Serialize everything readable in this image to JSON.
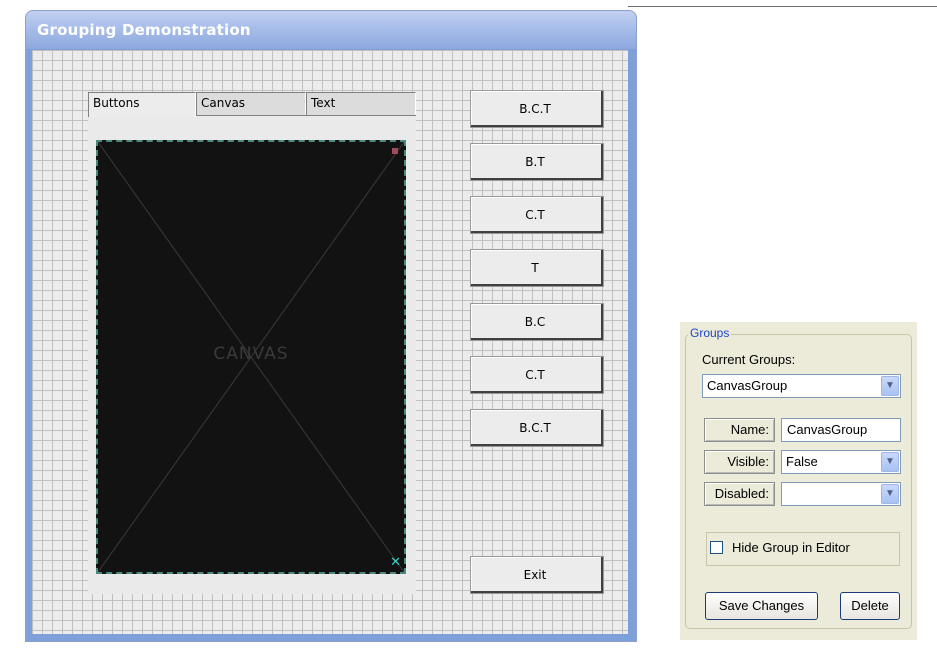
{
  "window": {
    "title": "Grouping Demonstration"
  },
  "tabs": [
    {
      "label": "Buttons"
    },
    {
      "label": "Canvas"
    },
    {
      "label": "Text"
    }
  ],
  "canvas": {
    "label": "CANVAS"
  },
  "side_buttons": [
    {
      "label": "B.C.T"
    },
    {
      "label": "B.T"
    },
    {
      "label": "C.T"
    },
    {
      "label": "T"
    },
    {
      "label": "B.C"
    },
    {
      "label": "C.T"
    },
    {
      "label": "B.C.T"
    }
  ],
  "exit_button": {
    "label": "Exit"
  },
  "groups_panel": {
    "legend": "Groups",
    "current_groups_label": "Current Groups:",
    "current_group_value": "CanvasGroup",
    "name_label": "Name:",
    "name_value": "CanvasGroup",
    "visible_label": "Visible:",
    "visible_value": "False",
    "disabled_label": "Disabled:",
    "disabled_value": "",
    "hide_group_label": "Hide Group in Editor",
    "hide_group_checked": false,
    "save_button": "Save Changes",
    "delete_button": "Delete"
  },
  "icons": {
    "dropdown": "chevron-down-icon",
    "canvas_close": "close-icon"
  },
  "colors": {
    "title_bar": "#9db4e6",
    "canvas_bg": "#121212",
    "groups_legend": "#1d47c9"
  }
}
